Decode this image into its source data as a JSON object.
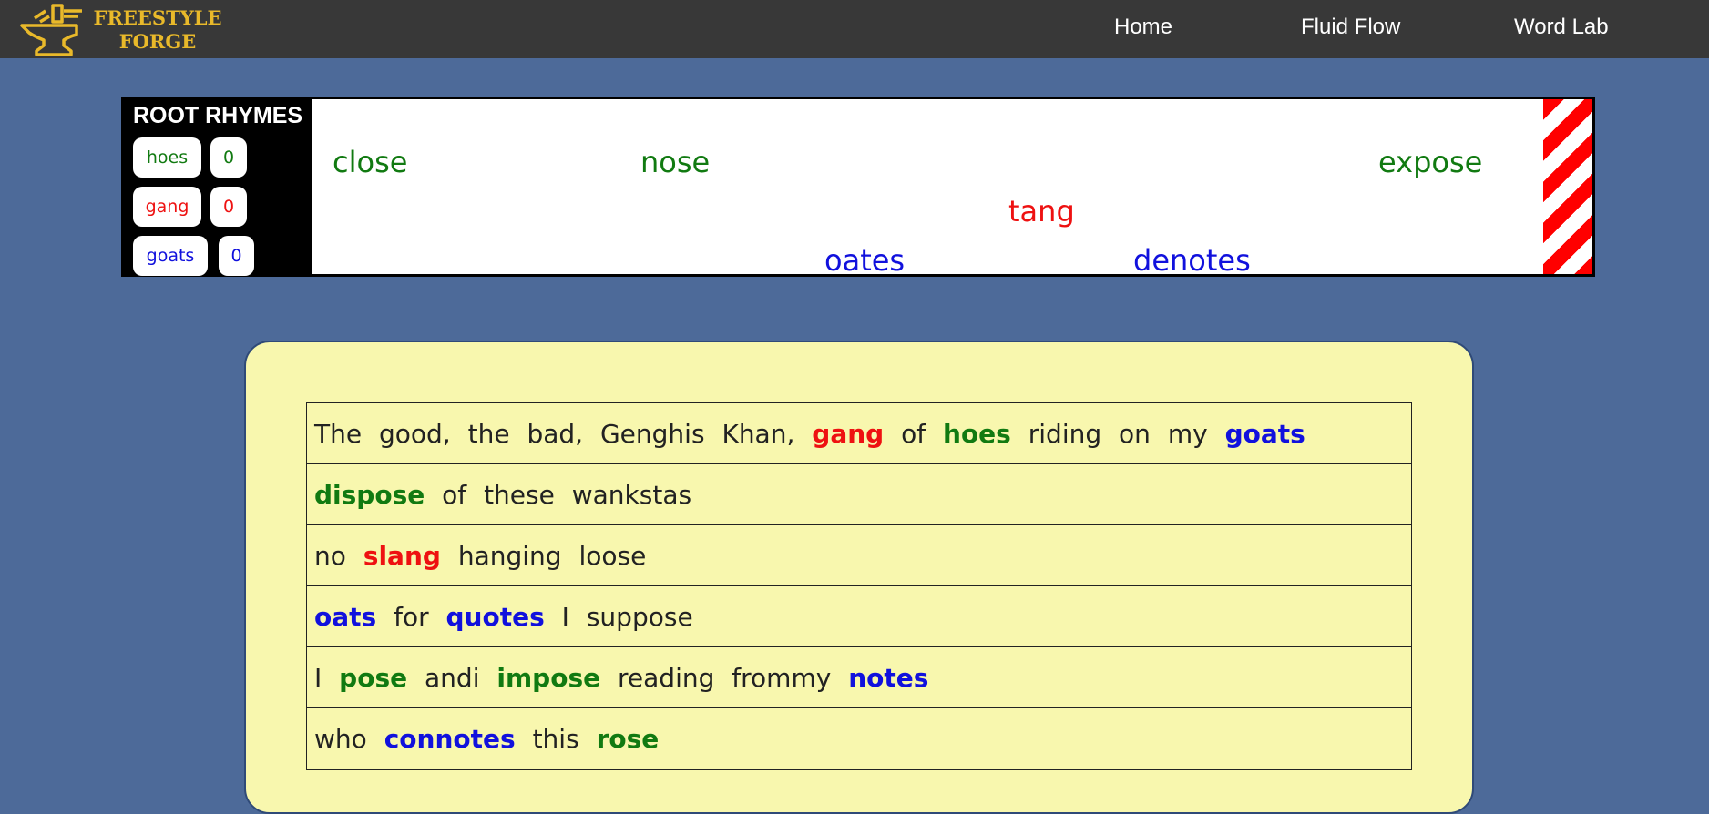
{
  "colors": {
    "background": "#4d6a99",
    "navbar": "#383838",
    "logo": "#e9b92a",
    "green": "#117a11",
    "red": "#ee1111",
    "blue": "#1111dd",
    "card": "#f8f7ae"
  },
  "nav": {
    "logo_line1": "FREESTYLE",
    "logo_line2": "FORGE",
    "logo_icon": "anvil-icon",
    "links": [
      "Home",
      "Fluid Flow",
      "Word Lab"
    ]
  },
  "rhymes": {
    "title": "ROOT RHYMES",
    "roots": [
      {
        "word": "hoes",
        "count": "0",
        "color": "green"
      },
      {
        "word": "gang",
        "count": "0",
        "color": "red"
      },
      {
        "word": "goats",
        "count": "0",
        "color": "blue"
      }
    ],
    "words": [
      {
        "text": "close",
        "color": "green"
      },
      {
        "text": "nose",
        "color": "green"
      },
      {
        "text": "expose",
        "color": "green"
      },
      {
        "text": "tang",
        "color": "red"
      },
      {
        "text": "oates",
        "color": "blue"
      },
      {
        "text": "denotes",
        "color": "blue"
      }
    ]
  },
  "lyrics": [
    [
      [
        "The",
        null
      ],
      [
        "good,",
        null
      ],
      [
        "the",
        null
      ],
      [
        "bad,",
        null
      ],
      [
        "Genghis",
        null
      ],
      [
        "Khan,",
        null
      ],
      [
        "gang",
        "red"
      ],
      [
        "of",
        null
      ],
      [
        "hoes",
        "green"
      ],
      [
        "riding",
        null
      ],
      [
        "on",
        null
      ],
      [
        "my",
        null
      ],
      [
        "goats",
        "blue"
      ]
    ],
    [
      [
        "dispose",
        "green"
      ],
      [
        "of",
        null
      ],
      [
        "these",
        null
      ],
      [
        "wankstas",
        null
      ]
    ],
    [
      [
        "no",
        null
      ],
      [
        "slang",
        "red"
      ],
      [
        "hanging",
        null
      ],
      [
        "loose",
        null
      ]
    ],
    [
      [
        "oats",
        "blue"
      ],
      [
        "for",
        null
      ],
      [
        "quotes",
        "blue"
      ],
      [
        "I",
        null
      ],
      [
        "suppose",
        null
      ]
    ],
    [
      [
        "I",
        null
      ],
      [
        "pose",
        "green"
      ],
      [
        "andi",
        null
      ],
      [
        "impose",
        "green"
      ],
      [
        "reading",
        null
      ],
      [
        "frommy",
        null
      ],
      [
        "notes",
        "blue"
      ]
    ],
    [
      [
        "who",
        null
      ],
      [
        "connotes",
        "blue"
      ],
      [
        "this",
        null
      ],
      [
        "rose",
        "green"
      ]
    ]
  ]
}
